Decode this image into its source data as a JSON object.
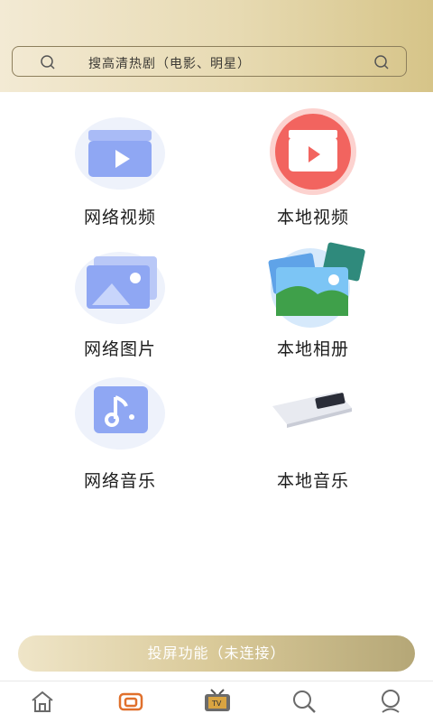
{
  "search": {
    "placeholder": "搜高清热剧（电影、明星）"
  },
  "features": [
    {
      "label": "网络视频",
      "icon": "clapperboard-icon"
    },
    {
      "label": "本地视频",
      "icon": "red-clapperboard-icon"
    },
    {
      "label": "网络图片",
      "icon": "image-icon"
    },
    {
      "label": "本地相册",
      "icon": "photo-album-icon"
    },
    {
      "label": "网络音乐",
      "icon": "music-note-icon"
    },
    {
      "label": "本地音乐",
      "icon": "phone-icon"
    }
  ],
  "cast_button": {
    "label": "投屏功能（未连接）"
  },
  "tabbar": {
    "items": [
      {
        "icon": "home-icon"
      },
      {
        "icon": "screen-cast-icon",
        "active": true
      },
      {
        "icon": "tv-icon"
      },
      {
        "icon": "search-icon"
      },
      {
        "icon": "profile-icon"
      }
    ]
  },
  "colors": {
    "accent": "#d9c998",
    "active_tab": "#e0702c"
  }
}
